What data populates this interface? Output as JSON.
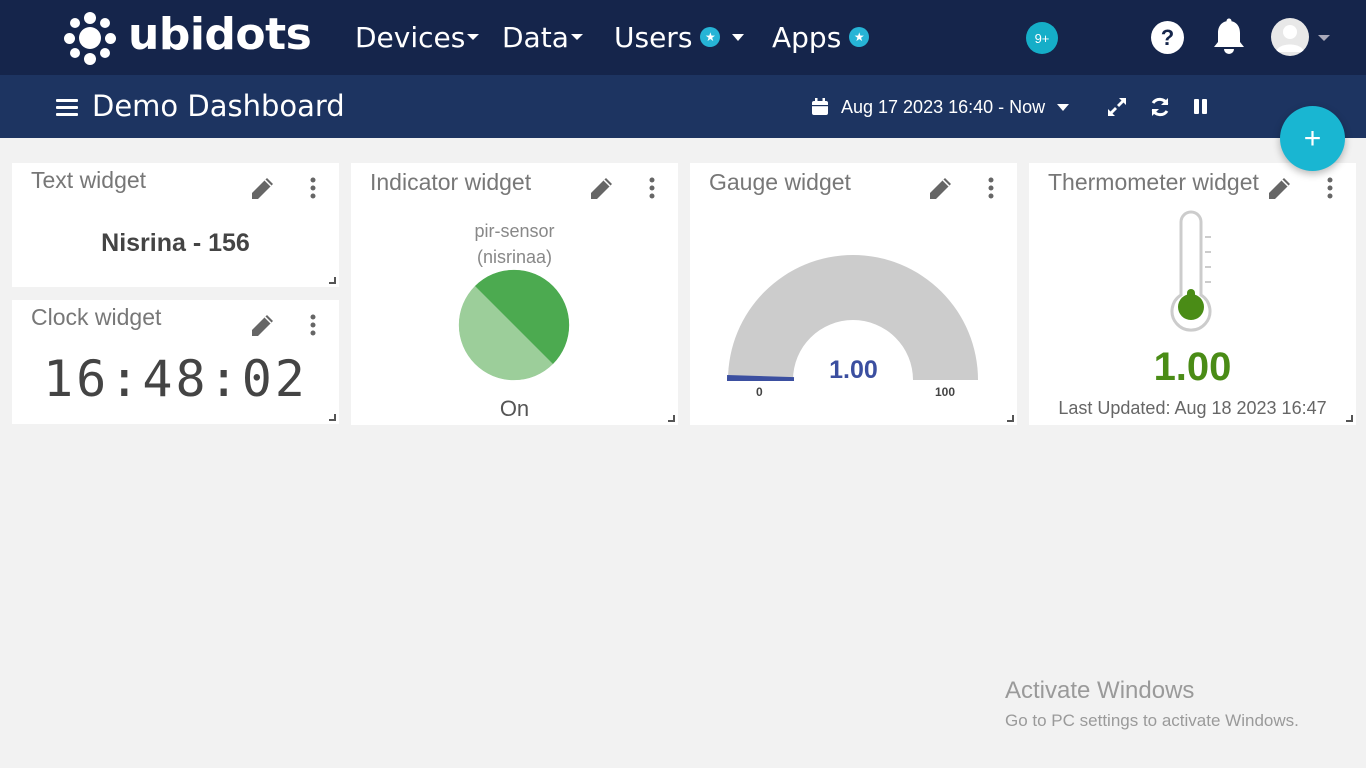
{
  "nav": {
    "brand": "ubidots",
    "items": [
      {
        "label": "Devices",
        "has_caret": true,
        "has_star": false
      },
      {
        "label": "Data",
        "has_caret": true,
        "has_star": false
      },
      {
        "label": "Users",
        "has_caret": true,
        "has_star": true
      },
      {
        "label": "Apps",
        "has_caret": false,
        "has_star": true
      }
    ],
    "notifications_badge": "9+",
    "help_label": "?"
  },
  "dashboard": {
    "title": "Demo Dashboard",
    "date_range": "Aug 17 2023 16:40 - Now",
    "add_label": "+"
  },
  "widgets": {
    "text": {
      "title": "Text widget",
      "value": "Nisrina - 156"
    },
    "clock": {
      "title": "Clock widget",
      "time": "16:48:02"
    },
    "indicator": {
      "title": "Indicator widget",
      "variable": "pir-sensor",
      "device": "(nisrinaa)",
      "state": "On"
    },
    "gauge": {
      "title": "Gauge widget",
      "value": "1.00",
      "value_fraction": 0.01,
      "min": "0",
      "max": "100"
    },
    "thermometer": {
      "title": "Thermometer widget",
      "value": "1.00",
      "last_updated": "Last Updated: Aug 18 2023 16:47"
    }
  },
  "colors": {
    "topnav": "#15254b",
    "subbar": "#1d3461",
    "accent": "#19b6d2",
    "indicator_on": "#4caa50",
    "indicator_light": "#9cce9a",
    "gauge_track": "#cccccc",
    "gauge_value": "#3b4fa0",
    "thermo_value": "#4a8c16"
  },
  "watermark": {
    "line1": "Activate Windows",
    "line2": "Go to PC settings to activate Windows."
  }
}
